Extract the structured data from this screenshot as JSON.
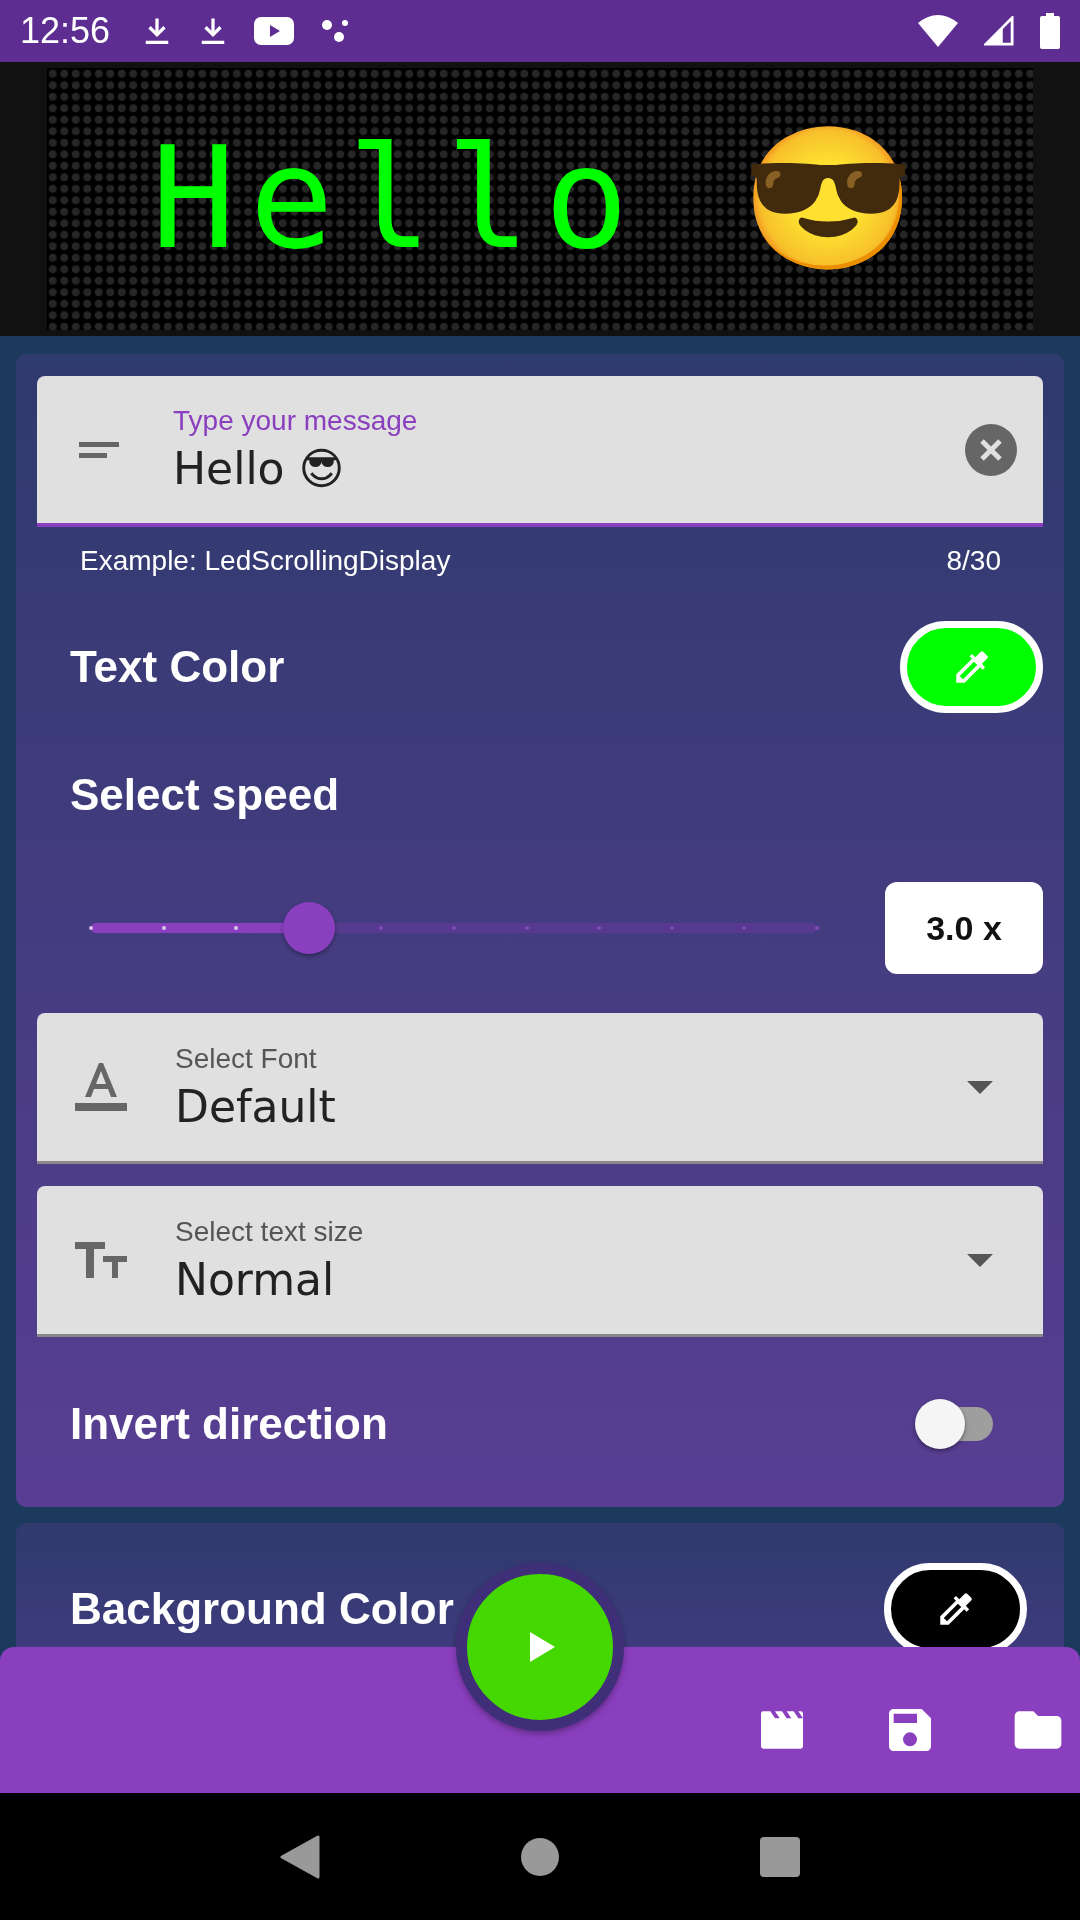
{
  "status_bar": {
    "time": "12:56"
  },
  "led_display": {
    "text": "Hello 😎"
  },
  "message_field": {
    "label": "Type your message",
    "value": "Hello 😎",
    "helper": "Example: LedScrollingDisplay",
    "counter": "8/30"
  },
  "text_color": {
    "label": "Text Color",
    "color": "#00ff00"
  },
  "speed": {
    "label": "Select speed",
    "level": 0.3,
    "reading": "3.0 x"
  },
  "dropdowns": [
    {
      "kind": "font",
      "label": "Select Font",
      "value": "Default"
    },
    {
      "kind": "size",
      "label": "Select text size",
      "value": "Normal"
    }
  ],
  "invert_direction": {
    "label": "Invert direction",
    "on": false
  },
  "background_color": {
    "label": "Background Color",
    "color": "#000000"
  }
}
